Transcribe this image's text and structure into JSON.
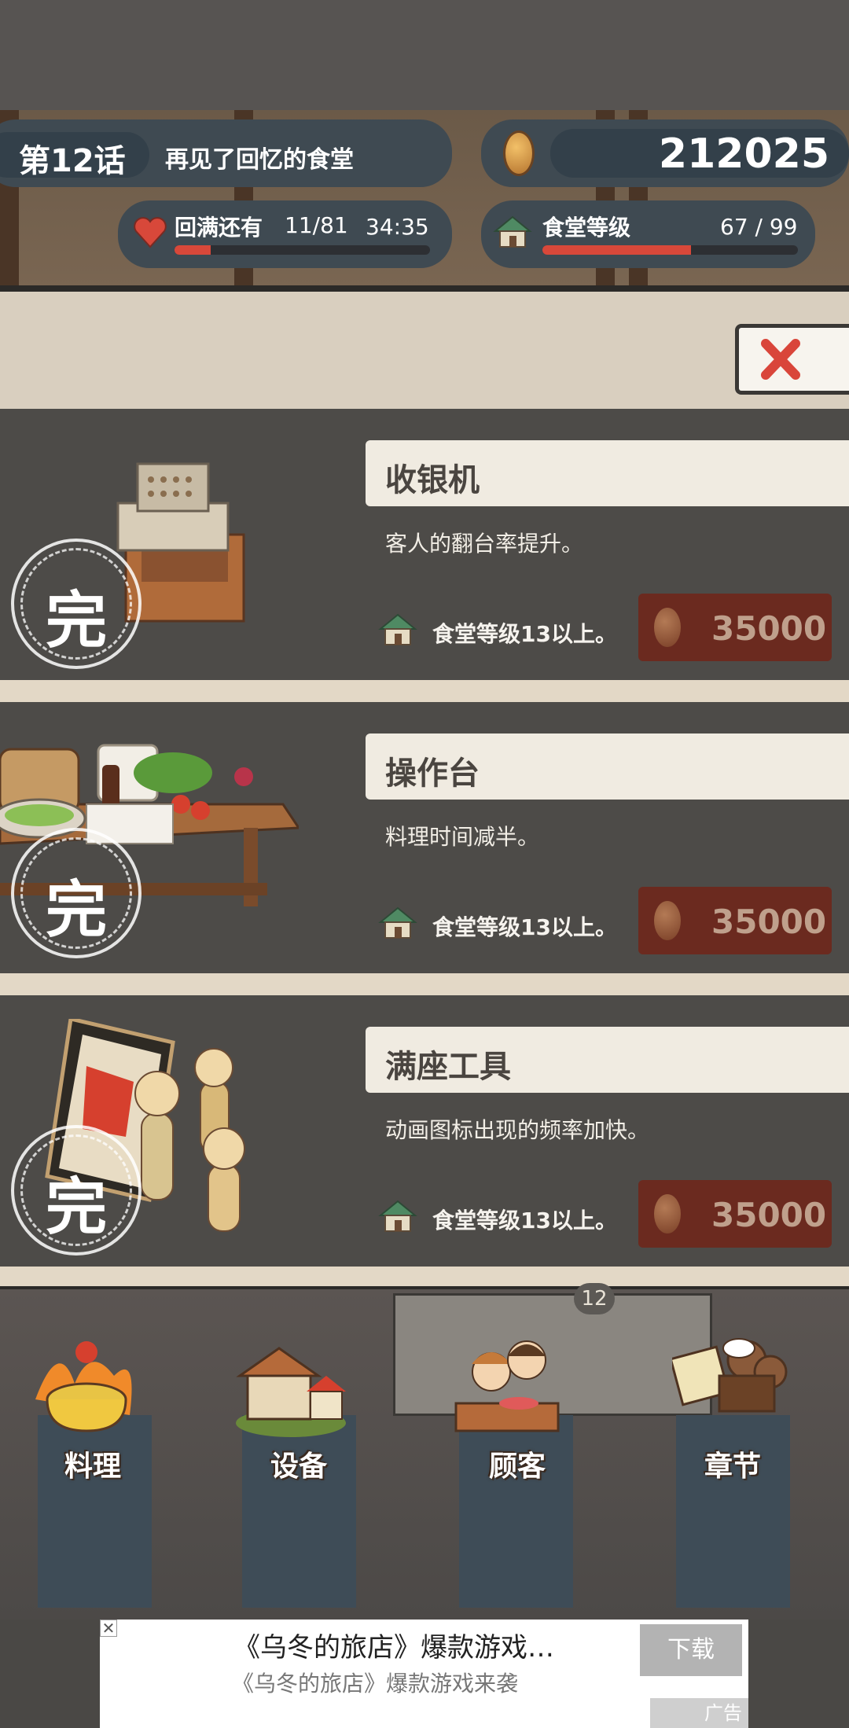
{
  "header": {
    "chapter_label": "第12话",
    "chapter_title": "再见了回忆的食堂",
    "coins": "212025",
    "stamina_label": "回满还有",
    "stamina_count": "11/81",
    "stamina_timer": "34:35",
    "stamina_progress": 0.14,
    "level_label": "食堂等级",
    "level_value": "67 / 99",
    "level_progress": 0.58
  },
  "close_button": {
    "icon": "close-x-icon",
    "color": "#d9453a"
  },
  "upgrades": [
    {
      "name": "收银机",
      "description": "客人的翻台率提升。",
      "requirement": "食堂等级13以上。",
      "price": "35000",
      "stamp": "完"
    },
    {
      "name": "操作台",
      "description": "料理时间减半。",
      "requirement": "食堂等级13以上。",
      "price": "35000",
      "stamp": "完"
    },
    {
      "name": "满座工具",
      "description": "动画图标出现的频率加快。",
      "requirement": "食堂等级13以上。",
      "price": "35000",
      "stamp": "完"
    }
  ],
  "table_number": "12",
  "nav": [
    {
      "label": "料理",
      "icon": "cooking-pot-icon"
    },
    {
      "label": "设备",
      "icon": "house-icon"
    },
    {
      "label": "顾客",
      "icon": "customers-icon"
    },
    {
      "label": "章节",
      "icon": "film-camera-icon"
    }
  ],
  "ad": {
    "title": "《乌冬的旅店》爆款游戏…",
    "subtitle": "《乌冬的旅店》爆款游戏来袭",
    "button": "下载",
    "tag": "广告"
  },
  "colors": {
    "accent_red": "#d8483a",
    "price_bg": "#6b2a1f",
    "card_bg": "#4d4b48"
  }
}
